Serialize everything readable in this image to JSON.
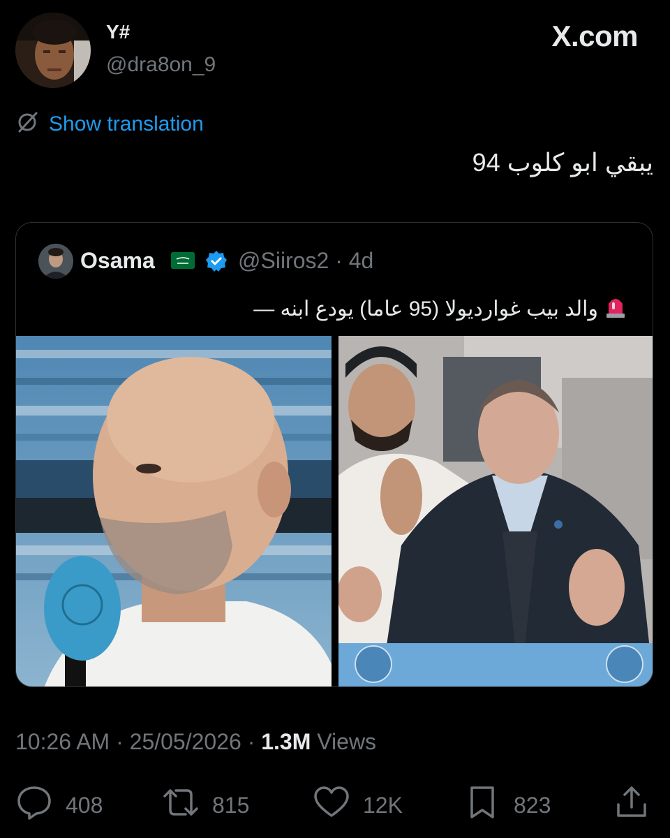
{
  "author": {
    "display_name": "Y#",
    "handle": "@dra8on_9"
  },
  "brand": {
    "name": "X.com"
  },
  "translation": {
    "label": "Show translation",
    "icon": "translate-off-icon"
  },
  "tweet": {
    "text": "يبقي ابو كلوب 94"
  },
  "quote": {
    "display_name": "Osama",
    "handle_time": "@Siiros2 · 4d",
    "text": "والد بيب غوارديولا (95 عاما) يودع ابنه —",
    "alert_icon": "rotating-light-icon"
  },
  "meta": {
    "time_date": "10:26 AM · 25/05/2026 · ",
    "views_count": "1.3M",
    "views_label": " Views"
  },
  "actions": {
    "replies": "408",
    "reposts": "815",
    "likes": "12K",
    "bookmarks": "823"
  },
  "colors": {
    "background": "#000000",
    "text": "#e7e9ea",
    "muted": "#71767b",
    "accent": "#1d9bf0",
    "verified": "#1d9bf0",
    "border": "#2f3336"
  }
}
